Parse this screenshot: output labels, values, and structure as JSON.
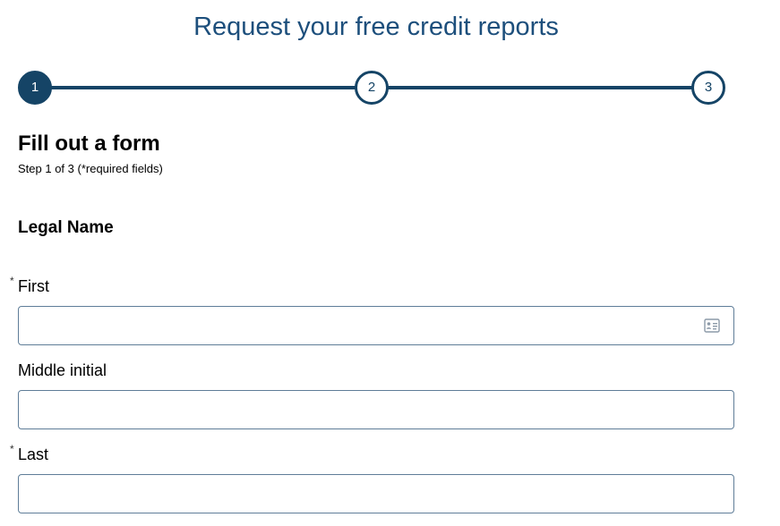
{
  "page": {
    "title": "Request your free credit reports"
  },
  "stepper": {
    "steps": [
      {
        "label": "1",
        "active": true
      },
      {
        "label": "2",
        "active": false
      },
      {
        "label": "3",
        "active": false
      }
    ],
    "accent_color": "#154466"
  },
  "form": {
    "heading": "Fill out a form",
    "subheading": "Step 1 of 3 (*required fields)",
    "section_heading": "Legal Name",
    "required_marker": "*",
    "fields": {
      "first": {
        "label": "First",
        "required": true,
        "value": "",
        "icon": "contact-card-icon"
      },
      "middle": {
        "label": "Middle initial",
        "required": false,
        "value": ""
      },
      "last": {
        "label": "Last",
        "required": true,
        "value": ""
      }
    }
  },
  "colors": {
    "title": "#1d4f7c",
    "input_border": "#5f7d98"
  }
}
